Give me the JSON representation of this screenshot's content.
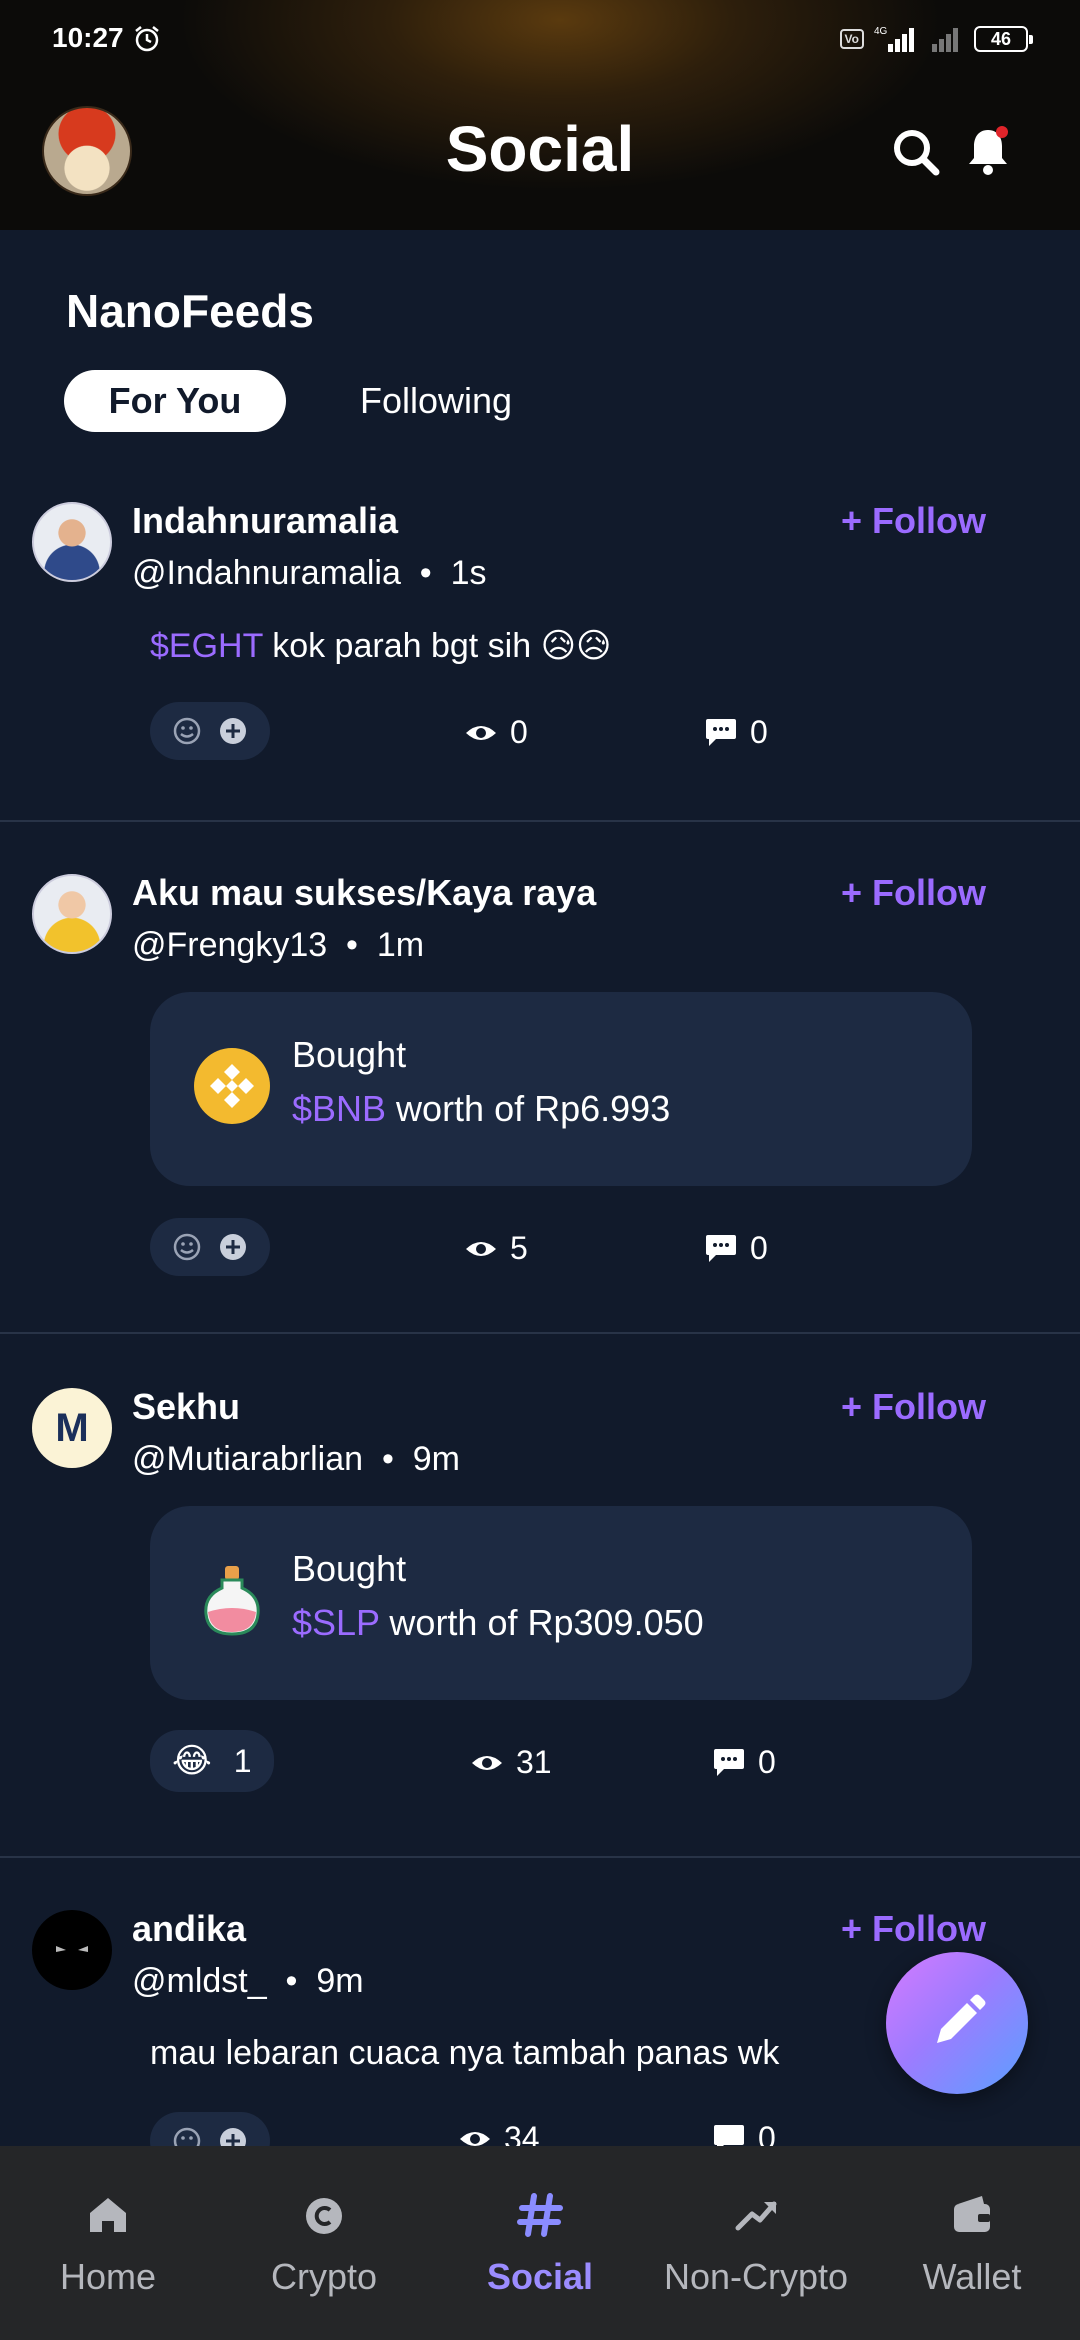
{
  "status_bar": {
    "time": "10:27",
    "network": "4G",
    "volte": "VoLTE",
    "battery": "46"
  },
  "header": {
    "title": "Social"
  },
  "feed": {
    "title": "NanoFeeds",
    "tabs": [
      {
        "label": "For You",
        "active": true
      },
      {
        "label": "Following",
        "active": false
      }
    ]
  },
  "posts": [
    {
      "name": "Indahnuramalia",
      "handle": "@Indahnuramalia",
      "time": "1s",
      "follow_label": "+ Follow",
      "ticker": "$EGHT",
      "text": " kok parah bgt sih 😥😥",
      "views": "0",
      "comments": "0"
    },
    {
      "name": "Aku mau sukses/Kaya raya",
      "handle": "@Frengky13",
      "time": "1m",
      "follow_label": "+ Follow",
      "trade": {
        "label": "Bought",
        "ticker": "$BNB",
        "detail": " worth of Rp6.993",
        "coin_color": "#f3ba2f"
      },
      "views": "5",
      "comments": "0"
    },
    {
      "name": "Sekhu",
      "handle": "@Mutiarabrlian",
      "time": "9m",
      "avatar_letter": "M",
      "follow_label": "+ Follow",
      "trade": {
        "label": "Bought",
        "ticker": "$SLP",
        "detail": " worth of Rp309.050",
        "coin_color": "#f28ca0"
      },
      "reaction_emoji": "😂",
      "reaction_count": "1",
      "views": "31",
      "comments": "0"
    },
    {
      "name": "andika",
      "handle": "@mldst_",
      "time": "9m",
      "follow_label": "+ Follow",
      "text": "mau lebaran cuaca nya tambah panas wk",
      "views": "34",
      "comments": "0"
    }
  ],
  "bottom_nav": [
    {
      "label": "Home",
      "icon": "home-icon",
      "active": false
    },
    {
      "label": "Crypto",
      "icon": "crypto-coin-icon",
      "active": false
    },
    {
      "label": "Social",
      "icon": "hashtag-icon",
      "active": true
    },
    {
      "label": "Non-Crypto",
      "icon": "trend-up-icon",
      "active": false
    },
    {
      "label": "Wallet",
      "icon": "wallet-icon",
      "active": false
    }
  ],
  "colors": {
    "accent": "#9b6bff",
    "background": "#111a2b",
    "card": "#1d2a42",
    "nav_active": "#9b8cff"
  }
}
